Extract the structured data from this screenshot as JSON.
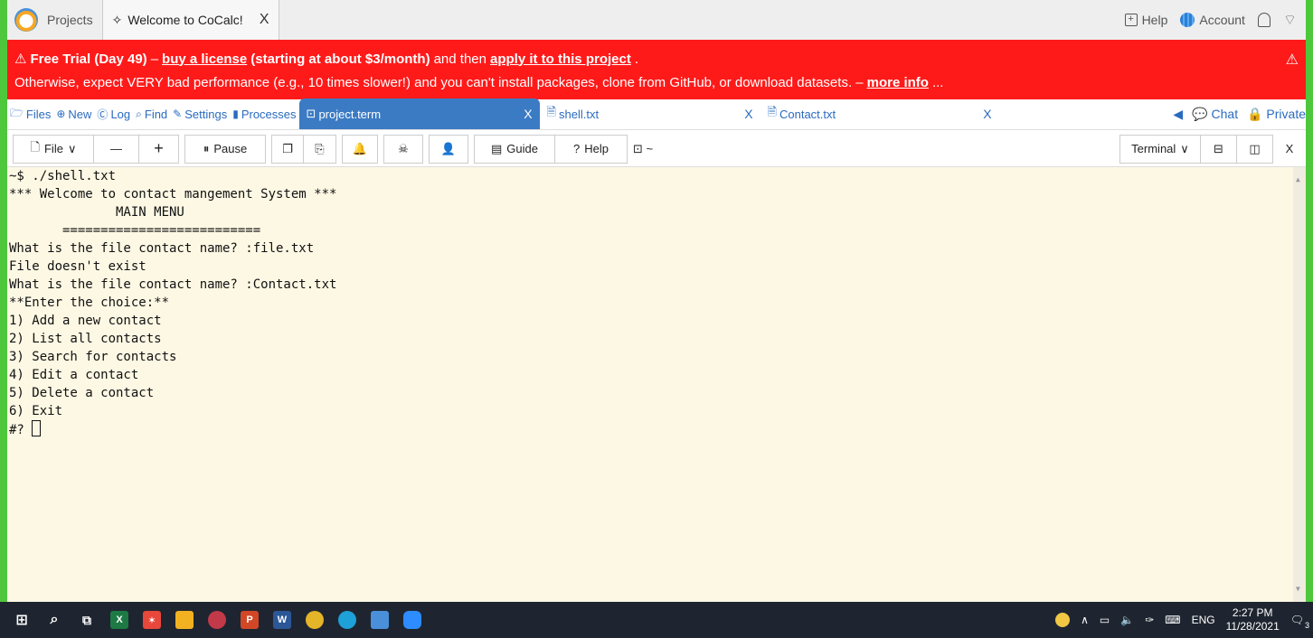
{
  "browser": {
    "tabs": [
      {
        "label": "Projects"
      },
      {
        "label": "Welcome to CoCalc!"
      }
    ],
    "help_label": "Help",
    "account_label": "Account"
  },
  "banner": {
    "prefix": "Free Trial (Day 49)",
    "dash1": "–",
    "buy_link": "buy a license",
    "pricing": "(starting at about $3/month)",
    "and_then": "and then",
    "apply_link": "apply it to this project",
    "period": ".",
    "line2": "Otherwise, expect VERY bad performance (e.g., 10 times slower!) and you can't install packages, clone from GitHub, or download datasets. –",
    "more_info": "more info",
    "ellipsis": "..."
  },
  "filetabs": {
    "nav": [
      {
        "label": "Files"
      },
      {
        "label": "New"
      },
      {
        "label": "Log"
      },
      {
        "label": "Find"
      },
      {
        "label": "Settings"
      },
      {
        "label": "Processes"
      }
    ],
    "open": [
      {
        "label": "project.term"
      },
      {
        "label": "shell.txt"
      },
      {
        "label": "Contact.txt"
      }
    ],
    "chat_label": "Chat",
    "private_label": "Private"
  },
  "toolbar": {
    "file_label": "File",
    "minus": "—",
    "plus": "+",
    "pause_label": "Pause",
    "guide_label": "Guide",
    "help_label": "Help",
    "path": "~",
    "terminal_label": "Terminal",
    "close": "X"
  },
  "terminal": {
    "lines": [
      "~$ ./shell.txt",
      "*** Welcome to contact mangement System ***",
      "              MAIN MENU",
      "       ==========================",
      "What is the file contact name? :file.txt",
      "File doesn't exist",
      "What is the file contact name? :Contact.txt",
      "**Enter the choice:**",
      "1) Add a new contact",
      "2) List all contacts",
      "3) Search for contacts",
      "4) Edit a contact",
      "5) Delete a contact",
      "6) Exit"
    ],
    "prompt": "#? "
  },
  "taskbar": {
    "lang": "ENG",
    "time": "2:27 PM",
    "date": "11/28/2021",
    "notification_count": "3"
  }
}
